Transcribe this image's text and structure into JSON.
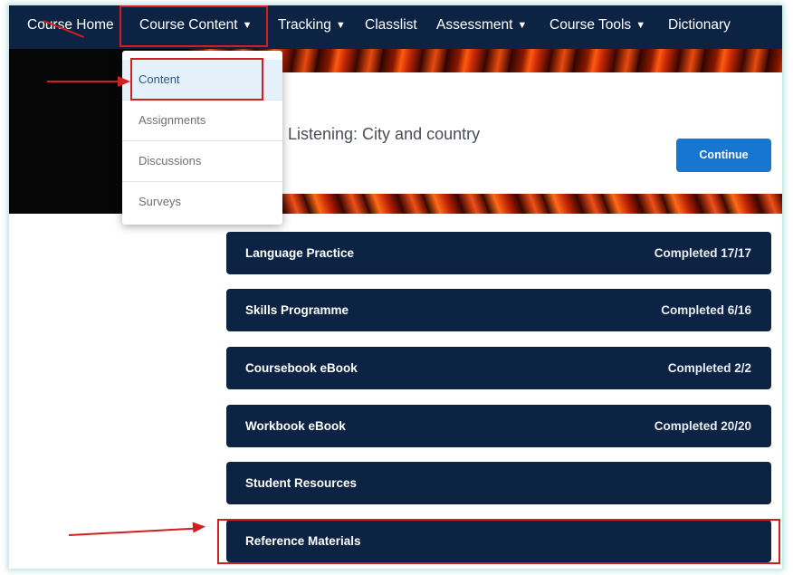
{
  "nav": {
    "items": [
      {
        "label": "Course Home",
        "dropdown": false
      },
      {
        "label": "Course Content",
        "dropdown": true
      },
      {
        "label": "Tracking",
        "dropdown": true
      },
      {
        "label": "Classlist",
        "dropdown": false
      },
      {
        "label": "Assessment",
        "dropdown": true
      },
      {
        "label": "Course Tools",
        "dropdown": true
      },
      {
        "label": "Dictionary",
        "dropdown": false
      }
    ]
  },
  "dropdown": {
    "items": [
      {
        "label": "Content",
        "active": true
      },
      {
        "label": "Assignments"
      },
      {
        "label": "Discussions"
      },
      {
        "label": "Surveys"
      }
    ]
  },
  "banner": {
    "title": "Listening: City and country",
    "continue_label": "Continue"
  },
  "modules": [
    {
      "title": "Language Practice",
      "status": "Completed 17/17"
    },
    {
      "title": "Skills Programme",
      "status": "Completed 6/16"
    },
    {
      "title": "Coursebook eBook",
      "status": "Completed 2/2"
    },
    {
      "title": "Workbook eBook",
      "status": "Completed 20/20"
    },
    {
      "title": "Student Resources",
      "status": ""
    },
    {
      "title": "Reference Materials",
      "status": ""
    }
  ],
  "colors": {
    "nav_bg": "#0c2344",
    "module_bg": "#0c2344",
    "accent_button": "#1676d1",
    "annotation_red": "#d11f1f",
    "dropdown_active_bg": "#e4f1fb"
  },
  "icons": {
    "chevron": "chevron-down-icon"
  }
}
